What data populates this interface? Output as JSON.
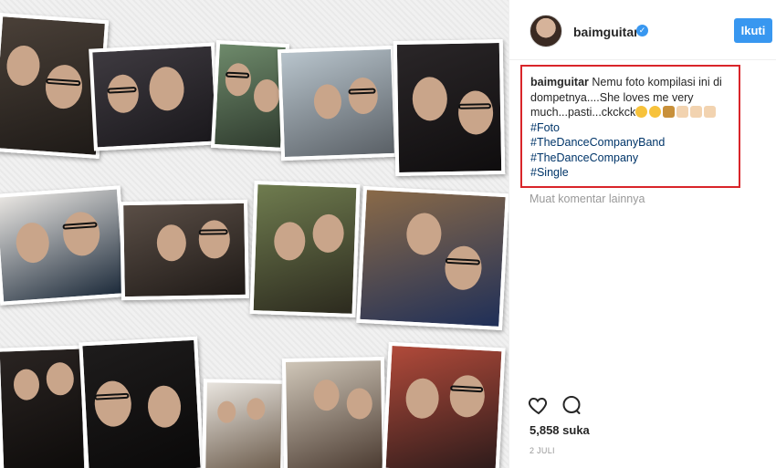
{
  "post": {
    "username": "baimguitar",
    "verified_icon": "verified-badge-icon",
    "follow_label": "Ikuti",
    "accent_color": "#3897f0"
  },
  "caption": {
    "username": "baimguitar",
    "text": "Nemu foto kompilasi ini di dompetnya....She loves me very much...pasti...ckckck",
    "emojis": [
      "winking-face-tongue",
      "grinning-face-tongue",
      "camel",
      "backhand-pointing-left",
      "backhand-pointing-left",
      "backhand-pointing-left"
    ],
    "hashtags": [
      "#Foto",
      "#TheDanceCompanyBand",
      "#TheDanceCompany",
      "#Single"
    ],
    "highlight_color": "#d9252a"
  },
  "comments": {
    "load_more_label": "Muat komentar lainnya"
  },
  "actions": {
    "like_icon": "heart-icon",
    "comment_icon": "comment-icon"
  },
  "stats": {
    "likes_label": "5,858 suka",
    "date_label": "2 JULI"
  }
}
